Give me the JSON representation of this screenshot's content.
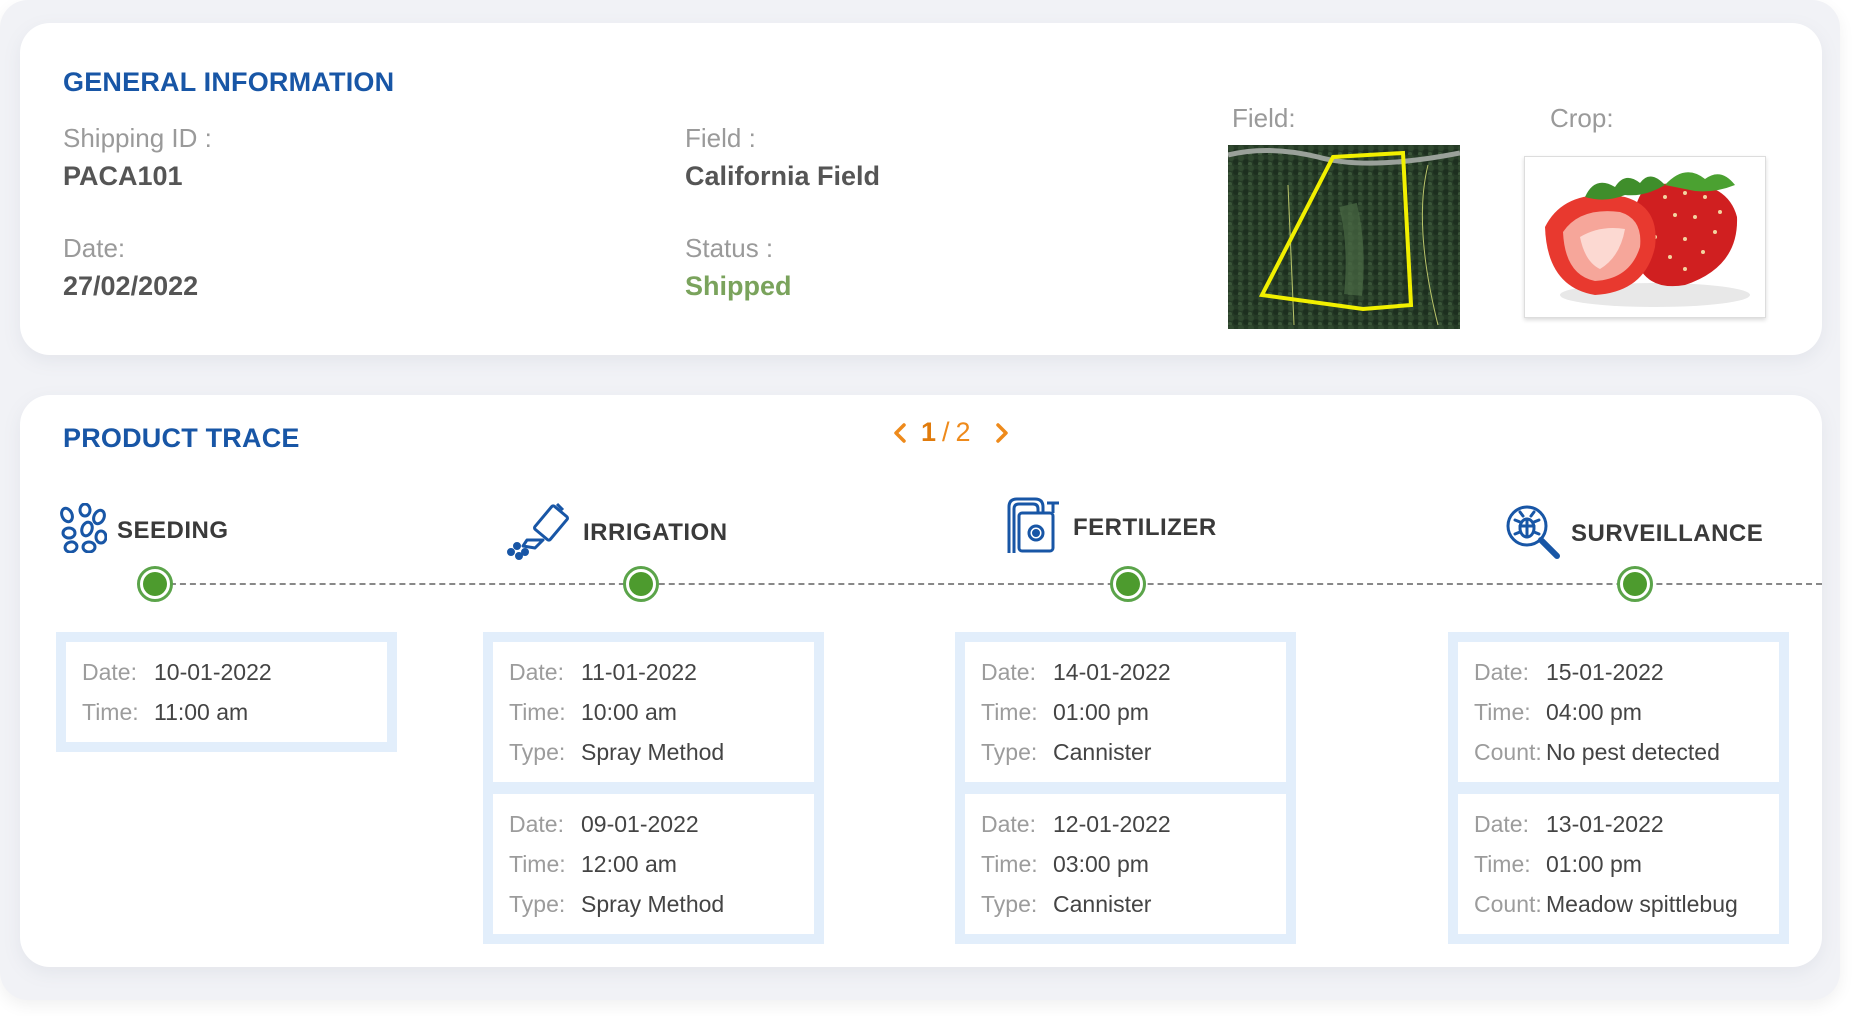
{
  "general": {
    "title": "GENERAL INFORMATION",
    "shipping_id_label": "Shipping ID :",
    "shipping_id": "PACA101",
    "date_label": "Date:",
    "date": "27/02/2022",
    "field_label": "Field :",
    "field": "California Field",
    "status_label": "Status :",
    "status": "Shipped",
    "field_img_label": "Field:",
    "crop_img_label": "Crop:"
  },
  "trace": {
    "title": "PRODUCT TRACE",
    "pager": {
      "current": "1",
      "separator": "/",
      "total": "2"
    },
    "stages": [
      {
        "name": "SEEDING",
        "icon": "seeds-icon",
        "entries": [
          {
            "rows": [
              [
                "Date:",
                "10-01-2022"
              ],
              [
                "Time:",
                "11:00 am"
              ]
            ]
          }
        ]
      },
      {
        "name": "IRRIGATION",
        "icon": "watering-can-icon",
        "entries": [
          {
            "rows": [
              [
                "Date:",
                "11-01-2022"
              ],
              [
                "Time:",
                "10:00 am"
              ],
              [
                "Type:",
                "Spray Method"
              ]
            ]
          },
          {
            "rows": [
              [
                "Date:",
                "09-01-2022"
              ],
              [
                "Time:",
                "12:00 am"
              ],
              [
                "Type:",
                "Spray Method"
              ]
            ]
          }
        ]
      },
      {
        "name": "FERTILIZER",
        "icon": "fertilizer-tank-icon",
        "entries": [
          {
            "rows": [
              [
                "Date:",
                "14-01-2022"
              ],
              [
                "Time:",
                "01:00 pm"
              ],
              [
                "Type:",
                "Cannister"
              ]
            ]
          },
          {
            "rows": [
              [
                "Date:",
                "12-01-2022"
              ],
              [
                "Time:",
                "03:00 pm"
              ],
              [
                "Type:",
                "Cannister"
              ]
            ]
          }
        ]
      },
      {
        "name": "SURVEILLANCE",
        "icon": "bug-magnifier-icon",
        "entries": [
          {
            "rows": [
              [
                "Date:",
                "15-01-2022"
              ],
              [
                "Time:",
                "04:00 pm"
              ],
              [
                "Count:",
                "No pest detected"
              ]
            ]
          },
          {
            "rows": [
              [
                "Date:",
                "13-01-2022"
              ],
              [
                "Time:",
                "01:00 pm"
              ],
              [
                "Count:",
                "Meadow spittlebug"
              ]
            ]
          }
        ]
      }
    ]
  },
  "colors": {
    "title_blue": "#1856a6",
    "status_green": "#7aa35c",
    "pager_orange": "#ee8a1b",
    "dot_green": "#4d9b2e",
    "detail_bg": "#e2eefb"
  }
}
